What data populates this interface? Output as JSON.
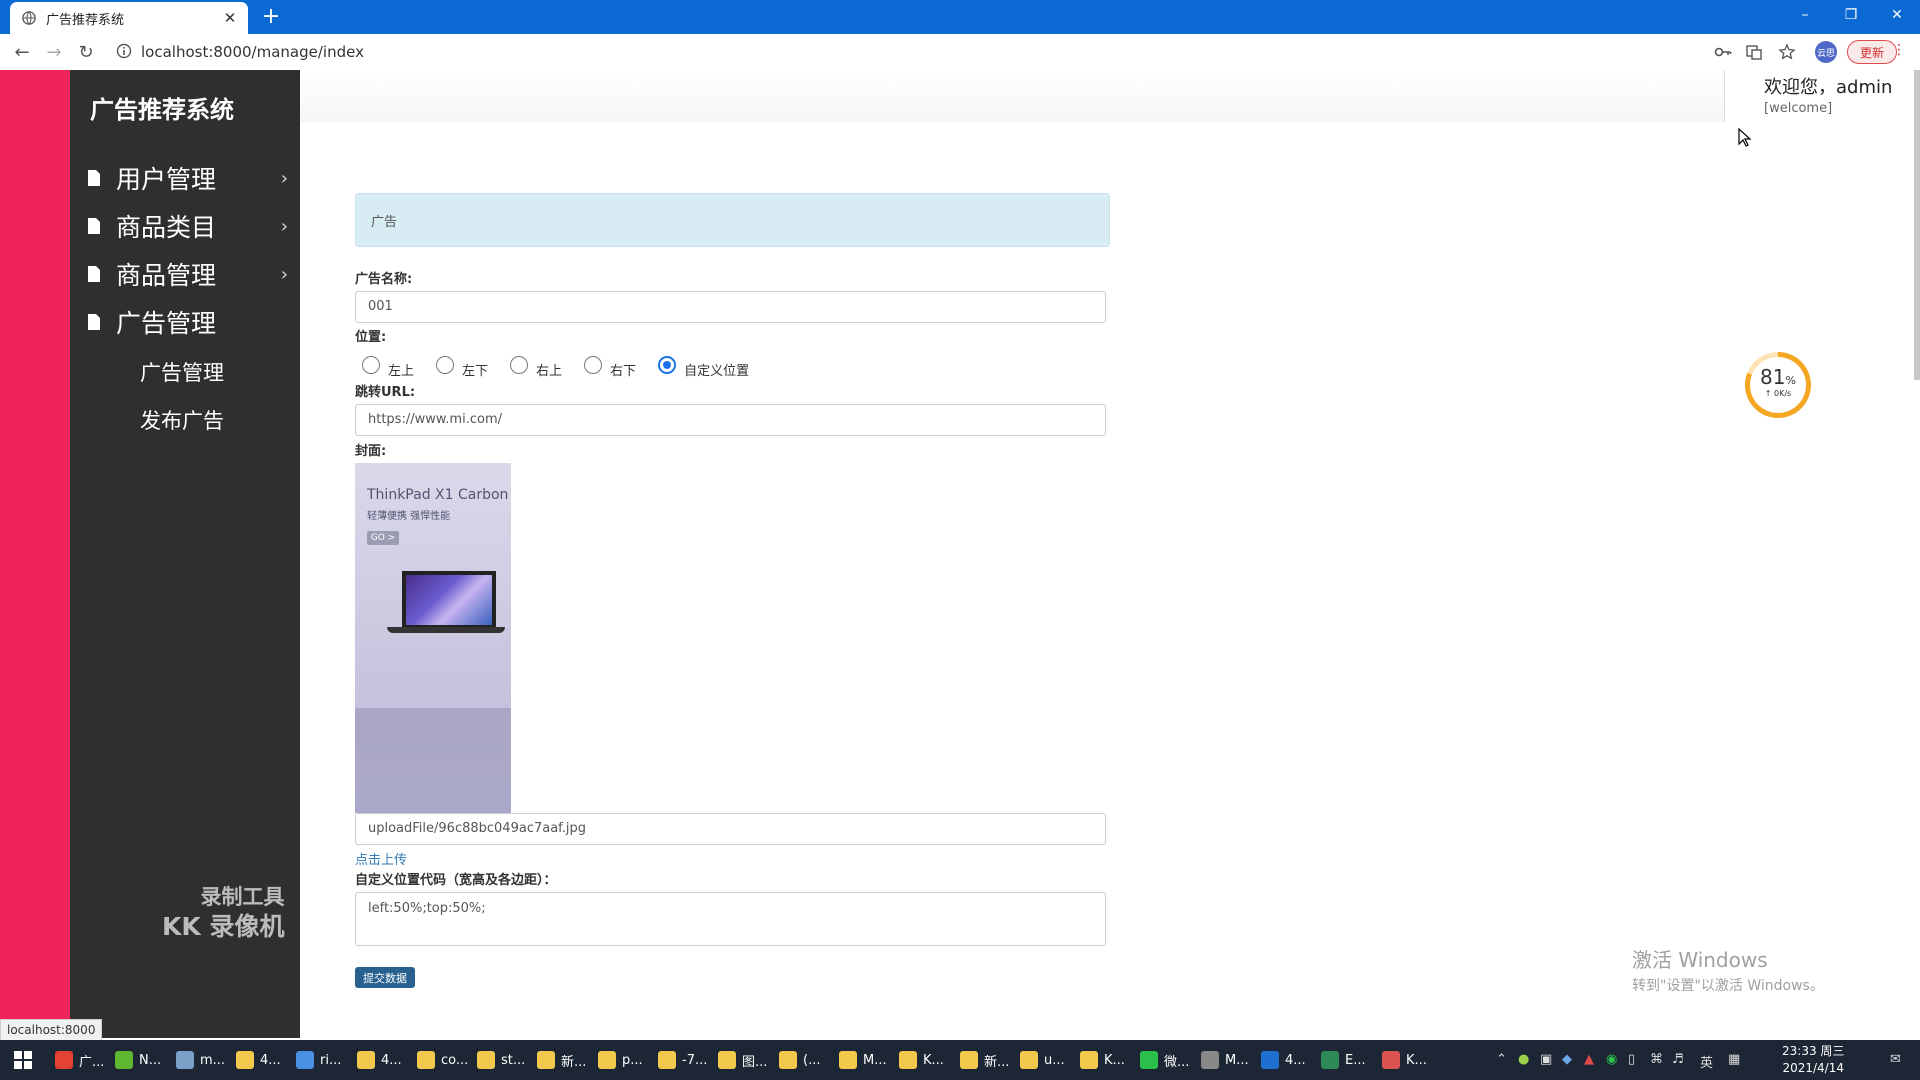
{
  "browser": {
    "tab_title": "广告推荐系统",
    "tab_close": "✕",
    "new_tab": "+",
    "url": "localhost:8000/manage/index",
    "avatar": "云思",
    "update_label": "更新",
    "status_url": "localhost:8000"
  },
  "sidebar": {
    "brand": "广告推荐系统",
    "items": [
      {
        "label": "用户管理"
      },
      {
        "label": "商品类目"
      },
      {
        "label": "商品管理"
      },
      {
        "label": "广告管理"
      }
    ],
    "sub_items": [
      {
        "label": "广告管理"
      },
      {
        "label": "发布广告"
      }
    ],
    "watermark_line1": "录制工具",
    "watermark_line2": "KK 录像机"
  },
  "header": {
    "welcome": "欢迎您，admin",
    "welcome_sub": "[welcome]"
  },
  "form": {
    "panel_title": "广告",
    "name_label": "广告名称:",
    "name_value": "001",
    "position_label": "位置:",
    "position_options": [
      "左上",
      "左下",
      "右上",
      "右下",
      "自定义位置"
    ],
    "position_selected": "自定义位置",
    "url_label": "跳转URL:",
    "url_value": "https://www.mi.com/",
    "cover_label": "封面:",
    "cover_text1": "ThinkPad X1 Carbon",
    "cover_text2": "轻薄便携 强悍性能",
    "cover_go": "GO >",
    "cover_path": "uploadFile/96c88bc049ac7aaf.jpg",
    "upload_link": "点击上传",
    "custom_label": "自定义位置代码（宽高及各边距）：",
    "custom_value": "left:50%;top:50%;",
    "submit_label": "提交数据"
  },
  "speed_widget": {
    "percent": 81,
    "percent_text": "81",
    "percent_sign": "%",
    "rate": "↑ 0K/s"
  },
  "watermark_os": {
    "line1": "激活 Windows",
    "line2": "转到\"设置\"以激活 Windows。"
  },
  "taskbar": {
    "apps": [
      {
        "label": "广...",
        "color": "#e34234"
      },
      {
        "label": "N...",
        "color": "#5fb832"
      },
      {
        "label": "m...",
        "color": "#7aa0c8"
      },
      {
        "label": "4...",
        "color": "#f2c94c"
      },
      {
        "label": "ri...",
        "color": "#4a90e2"
      },
      {
        "label": "4...",
        "color": "#f2c94c"
      },
      {
        "label": "co...",
        "color": "#f2c94c"
      },
      {
        "label": "st...",
        "color": "#f2c94c"
      },
      {
        "label": "新...",
        "color": "#f2c94c"
      },
      {
        "label": "p...",
        "color": "#f2c94c"
      },
      {
        "label": "-7...",
        "color": "#f2c94c"
      },
      {
        "label": "图...",
        "color": "#f2c94c"
      },
      {
        "label": "(...",
        "color": "#f2c94c"
      },
      {
        "label": "M...",
        "color": "#f2c94c"
      },
      {
        "label": "K...",
        "color": "#f2c94c"
      },
      {
        "label": "新...",
        "color": "#f2c94c"
      },
      {
        "label": "u...",
        "color": "#f2c94c"
      },
      {
        "label": "K...",
        "color": "#f2c94c"
      },
      {
        "label": "微...",
        "color": "#2bc04b"
      },
      {
        "label": "M...",
        "color": "#888888"
      },
      {
        "label": "4...",
        "color": "#1e6fd0"
      },
      {
        "label": "E...",
        "color": "#2e8b57"
      },
      {
        "label": "K...",
        "color": "#d9534f"
      }
    ],
    "ime": "英",
    "time": "23:33 周三",
    "date": "2021/4/14"
  },
  "colors": {
    "accent_pink": "#f0245a",
    "sidebar_bg": "#2f2f2f",
    "browser_blue": "#0a69d2",
    "panel_head": "#d8edf3",
    "button_blue": "#286090",
    "link": "#337ab7"
  }
}
